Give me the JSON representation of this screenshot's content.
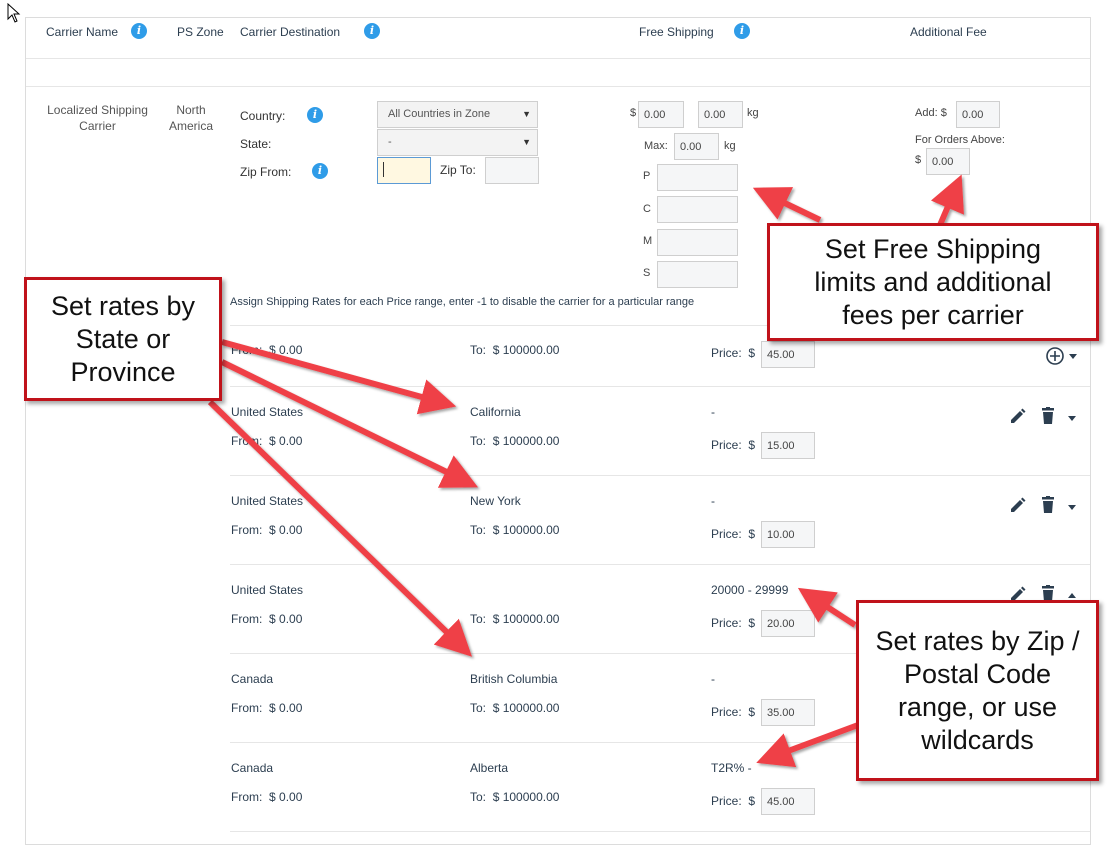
{
  "header": {
    "carrier_name": "Carrier Name",
    "ps_zone": "PS Zone",
    "carrier_destination": "Carrier Destination",
    "free_shipping": "Free Shipping",
    "additional_fee": "Additional Fee"
  },
  "carrier": {
    "name_line1": "Localized Shipping",
    "name_line2": "Carrier",
    "zone_line1": "North",
    "zone_line2": "America"
  },
  "destination": {
    "country_label": "Country:",
    "country_value": "All Countries in Zone",
    "state_label": "State:",
    "state_value": "-",
    "zip_from_label": "Zip From:",
    "zip_from_value": "",
    "zip_to_label": "Zip To:",
    "zip_to_value": ""
  },
  "free_shipping": {
    "currency": "$",
    "amount": "0.00",
    "weight": "0.00",
    "weight_unit": "kg",
    "max_label": "Max:",
    "max_value": "0.00",
    "max_unit": "kg",
    "p_label": "P",
    "c_label": "C",
    "m_label": "M",
    "s_label": "S"
  },
  "additional_fee": {
    "add_label": "Add:",
    "currency": "$",
    "add_value": "0.00",
    "orders_above_label": "For Orders Above:",
    "orders_above_currency": "$",
    "orders_above_value": "0.00"
  },
  "assign_text": "Assign Shipping Rates for each Price range, enter -1 to disable the carrier for a particular range",
  "labels": {
    "from": "From:",
    "to": "To:",
    "price": "Price:",
    "dollar": "$"
  },
  "default_rate": {
    "from": "$ 0.00",
    "to": "$ 100000.00",
    "price": "45.00"
  },
  "rates": [
    {
      "country": "United States",
      "region": "California",
      "zip": "-",
      "from": "$ 0.00",
      "to": "$ 100000.00",
      "price": "15.00"
    },
    {
      "country": "United States",
      "region": "New York",
      "zip": "-",
      "from": "$ 0.00",
      "to": "$ 100000.00",
      "price": "10.00"
    },
    {
      "country": "United States",
      "region": "",
      "zip": "20000 - 29999",
      "from": "$ 0.00",
      "to": "$ 100000.00",
      "price": "20.00"
    },
    {
      "country": "Canada",
      "region": "British Columbia",
      "zip": "-",
      "from": "$ 0.00",
      "to": "$ 100000.00",
      "price": "35.00"
    },
    {
      "country": "Canada",
      "region": "Alberta",
      "zip": "T2R% -",
      "from": "$ 0.00",
      "to": "$ 100000.00",
      "price": "45.00"
    }
  ],
  "callouts": {
    "free_shipping": [
      "Set Free Shipping",
      "limits and additional",
      "fees per carrier"
    ],
    "state": [
      "Set rates by",
      "State or",
      "Province"
    ],
    "zip": [
      "Set rates by Zip /",
      "Postal Code",
      "range, or use",
      "wildcards"
    ]
  },
  "colors": {
    "info_icon": "#2f9ce8",
    "callout_border": "#c0121a",
    "arrow": "#ef4146"
  },
  "icons": {
    "info": "info-icon",
    "edit": "pencil-icon",
    "delete": "trash-icon",
    "add": "plus-circle-icon",
    "dropdown": "caret-down-icon"
  }
}
